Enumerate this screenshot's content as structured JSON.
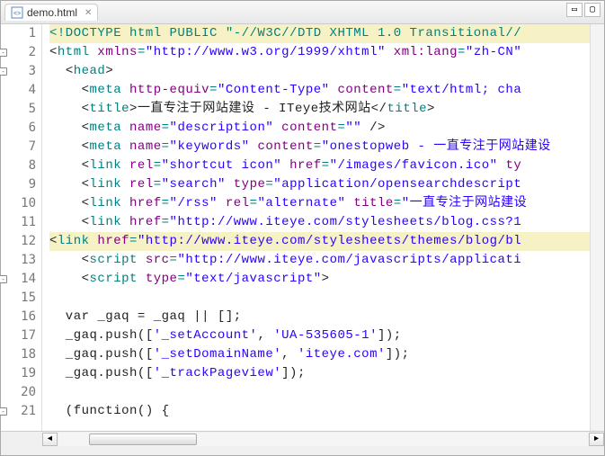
{
  "tab": {
    "label": "demo.html",
    "close_glyph": "✕"
  },
  "window": {
    "min_glyph": "▭",
    "max_glyph": "▢"
  },
  "lines": [
    {
      "n": 1,
      "fold": null,
      "hilite": true,
      "segs": [
        {
          "c": "tok-doctype",
          "t": "<!DOCTYPE html PUBLIC \"-//W3C//DTD XHTML 1.0 Transitional//"
        }
      ]
    },
    {
      "n": 2,
      "fold": "-",
      "hilite": false,
      "segs": [
        {
          "c": "tok-bracket",
          "t": "<"
        },
        {
          "c": "tok-tag",
          "t": "html "
        },
        {
          "c": "tok-attr",
          "t": "xmlns"
        },
        {
          "c": "tok-tag",
          "t": "="
        },
        {
          "c": "tok-str",
          "t": "\"http://www.w3.org/1999/xhtml\""
        },
        {
          "c": "tok-tag",
          "t": " "
        },
        {
          "c": "tok-attr",
          "t": "xml:lang"
        },
        {
          "c": "tok-tag",
          "t": "="
        },
        {
          "c": "tok-str",
          "t": "\"zh-CN\""
        }
      ]
    },
    {
      "n": 3,
      "fold": "-",
      "hilite": false,
      "segs": [
        {
          "c": "tok-text",
          "t": "  "
        },
        {
          "c": "tok-bracket",
          "t": "<"
        },
        {
          "c": "tok-tag",
          "t": "head"
        },
        {
          "c": "tok-bracket",
          "t": ">"
        }
      ]
    },
    {
      "n": 4,
      "fold": null,
      "hilite": false,
      "segs": [
        {
          "c": "tok-text",
          "t": "    "
        },
        {
          "c": "tok-bracket",
          "t": "<"
        },
        {
          "c": "tok-tag",
          "t": "meta "
        },
        {
          "c": "tok-attr",
          "t": "http-equiv"
        },
        {
          "c": "tok-tag",
          "t": "="
        },
        {
          "c": "tok-str",
          "t": "\"Content-Type\""
        },
        {
          "c": "tok-tag",
          "t": " "
        },
        {
          "c": "tok-attr",
          "t": "content"
        },
        {
          "c": "tok-tag",
          "t": "="
        },
        {
          "c": "tok-str",
          "t": "\"text/html; cha"
        }
      ]
    },
    {
      "n": 5,
      "fold": null,
      "hilite": false,
      "segs": [
        {
          "c": "tok-text",
          "t": "    "
        },
        {
          "c": "tok-bracket",
          "t": "<"
        },
        {
          "c": "tok-tag",
          "t": "title"
        },
        {
          "c": "tok-bracket",
          "t": ">"
        },
        {
          "c": "tok-text",
          "t": "一直专注于网站建设 - ITeye技术网站"
        },
        {
          "c": "tok-bracket",
          "t": "</"
        },
        {
          "c": "tok-tag",
          "t": "title"
        },
        {
          "c": "tok-bracket",
          "t": ">"
        }
      ]
    },
    {
      "n": 6,
      "fold": null,
      "hilite": false,
      "segs": [
        {
          "c": "tok-text",
          "t": "    "
        },
        {
          "c": "tok-bracket",
          "t": "<"
        },
        {
          "c": "tok-tag",
          "t": "meta "
        },
        {
          "c": "tok-attr",
          "t": "name"
        },
        {
          "c": "tok-tag",
          "t": "="
        },
        {
          "c": "tok-str",
          "t": "\"description\""
        },
        {
          "c": "tok-tag",
          "t": " "
        },
        {
          "c": "tok-attr",
          "t": "content"
        },
        {
          "c": "tok-tag",
          "t": "="
        },
        {
          "c": "tok-str",
          "t": "\"\""
        },
        {
          "c": "tok-tag",
          "t": " "
        },
        {
          "c": "tok-bracket",
          "t": "/>"
        }
      ]
    },
    {
      "n": 7,
      "fold": null,
      "hilite": false,
      "segs": [
        {
          "c": "tok-text",
          "t": "    "
        },
        {
          "c": "tok-bracket",
          "t": "<"
        },
        {
          "c": "tok-tag",
          "t": "meta "
        },
        {
          "c": "tok-attr",
          "t": "name"
        },
        {
          "c": "tok-tag",
          "t": "="
        },
        {
          "c": "tok-str",
          "t": "\"keywords\""
        },
        {
          "c": "tok-tag",
          "t": " "
        },
        {
          "c": "tok-attr",
          "t": "content"
        },
        {
          "c": "tok-tag",
          "t": "="
        },
        {
          "c": "tok-str",
          "t": "\"onestopweb - 一直专注于网站建设"
        }
      ]
    },
    {
      "n": 8,
      "fold": null,
      "hilite": false,
      "segs": [
        {
          "c": "tok-text",
          "t": "    "
        },
        {
          "c": "tok-bracket",
          "t": "<"
        },
        {
          "c": "tok-tag",
          "t": "link "
        },
        {
          "c": "tok-attr",
          "t": "rel"
        },
        {
          "c": "tok-tag",
          "t": "="
        },
        {
          "c": "tok-str",
          "t": "\"shortcut icon\""
        },
        {
          "c": "tok-tag",
          "t": " "
        },
        {
          "c": "tok-attr",
          "t": "href"
        },
        {
          "c": "tok-tag",
          "t": "="
        },
        {
          "c": "tok-str",
          "t": "\"/images/favicon.ico\""
        },
        {
          "c": "tok-tag",
          "t": " "
        },
        {
          "c": "tok-attr",
          "t": "ty"
        }
      ]
    },
    {
      "n": 9,
      "fold": null,
      "hilite": false,
      "segs": [
        {
          "c": "tok-text",
          "t": "    "
        },
        {
          "c": "tok-bracket",
          "t": "<"
        },
        {
          "c": "tok-tag",
          "t": "link "
        },
        {
          "c": "tok-attr",
          "t": "rel"
        },
        {
          "c": "tok-tag",
          "t": "="
        },
        {
          "c": "tok-str",
          "t": "\"search\""
        },
        {
          "c": "tok-tag",
          "t": " "
        },
        {
          "c": "tok-attr",
          "t": "type"
        },
        {
          "c": "tok-tag",
          "t": "="
        },
        {
          "c": "tok-str",
          "t": "\"application/opensearchdescript"
        }
      ]
    },
    {
      "n": 10,
      "fold": null,
      "hilite": false,
      "segs": [
        {
          "c": "tok-text",
          "t": "    "
        },
        {
          "c": "tok-bracket",
          "t": "<"
        },
        {
          "c": "tok-tag",
          "t": "link "
        },
        {
          "c": "tok-attr",
          "t": "href"
        },
        {
          "c": "tok-tag",
          "t": "="
        },
        {
          "c": "tok-str",
          "t": "\"/rss\""
        },
        {
          "c": "tok-tag",
          "t": " "
        },
        {
          "c": "tok-attr",
          "t": "rel"
        },
        {
          "c": "tok-tag",
          "t": "="
        },
        {
          "c": "tok-str",
          "t": "\"alternate\""
        },
        {
          "c": "tok-tag",
          "t": " "
        },
        {
          "c": "tok-attr",
          "t": "title"
        },
        {
          "c": "tok-tag",
          "t": "="
        },
        {
          "c": "tok-str",
          "t": "\"一直专注于网站建设"
        }
      ]
    },
    {
      "n": 11,
      "fold": null,
      "hilite": false,
      "segs": [
        {
          "c": "tok-text",
          "t": "    "
        },
        {
          "c": "tok-bracket",
          "t": "<"
        },
        {
          "c": "tok-tag",
          "t": "link "
        },
        {
          "c": "tok-attr",
          "t": "href"
        },
        {
          "c": "tok-tag",
          "t": "="
        },
        {
          "c": "tok-str",
          "t": "\"http://www.iteye.com/stylesheets/blog.css?1"
        }
      ]
    },
    {
      "n": 12,
      "fold": null,
      "hilite": true,
      "segs": [
        {
          "c": "tok-bracket",
          "t": "<"
        },
        {
          "c": "tok-tag",
          "t": "link "
        },
        {
          "c": "tok-attr",
          "t": "href"
        },
        {
          "c": "tok-tag",
          "t": "="
        },
        {
          "c": "tok-str",
          "t": "\"http://www.iteye.com/stylesheets/themes/blog/bl"
        }
      ]
    },
    {
      "n": 13,
      "fold": null,
      "hilite": false,
      "segs": [
        {
          "c": "tok-text",
          "t": "    "
        },
        {
          "c": "tok-bracket",
          "t": "<"
        },
        {
          "c": "tok-tag",
          "t": "script "
        },
        {
          "c": "tok-attr",
          "t": "src"
        },
        {
          "c": "tok-tag",
          "t": "="
        },
        {
          "c": "tok-str",
          "t": "\"http://www.iteye.com/javascripts/applicati"
        }
      ]
    },
    {
      "n": 14,
      "fold": "-",
      "hilite": false,
      "segs": [
        {
          "c": "tok-text",
          "t": "    "
        },
        {
          "c": "tok-bracket",
          "t": "<"
        },
        {
          "c": "tok-tag",
          "t": "script "
        },
        {
          "c": "tok-attr",
          "t": "type"
        },
        {
          "c": "tok-tag",
          "t": "="
        },
        {
          "c": "tok-str",
          "t": "\"text/javascript\""
        },
        {
          "c": "tok-bracket",
          "t": ">"
        }
      ]
    },
    {
      "n": 15,
      "fold": null,
      "hilite": false,
      "segs": [
        {
          "c": "tok-text",
          "t": ""
        }
      ]
    },
    {
      "n": 16,
      "fold": null,
      "hilite": false,
      "segs": [
        {
          "c": "tok-js",
          "t": "  var _gaq = _gaq || [];"
        }
      ]
    },
    {
      "n": 17,
      "fold": null,
      "hilite": false,
      "segs": [
        {
          "c": "tok-js",
          "t": "  _gaq.push(["
        },
        {
          "c": "tok-jsstr",
          "t": "'_setAccount'"
        },
        {
          "c": "tok-js",
          "t": ", "
        },
        {
          "c": "tok-jsstr",
          "t": "'UA-535605-1'"
        },
        {
          "c": "tok-js",
          "t": "]);"
        }
      ]
    },
    {
      "n": 18,
      "fold": null,
      "hilite": false,
      "segs": [
        {
          "c": "tok-js",
          "t": "  _gaq.push(["
        },
        {
          "c": "tok-jsstr",
          "t": "'_setDomainName'"
        },
        {
          "c": "tok-js",
          "t": ", "
        },
        {
          "c": "tok-jsstr",
          "t": "'iteye.com'"
        },
        {
          "c": "tok-js",
          "t": "]);"
        }
      ]
    },
    {
      "n": 19,
      "fold": null,
      "hilite": false,
      "segs": [
        {
          "c": "tok-js",
          "t": "  _gaq.push(["
        },
        {
          "c": "tok-jsstr",
          "t": "'_trackPageview'"
        },
        {
          "c": "tok-js",
          "t": "]);"
        }
      ]
    },
    {
      "n": 20,
      "fold": null,
      "hilite": false,
      "segs": [
        {
          "c": "tok-text",
          "t": ""
        }
      ]
    },
    {
      "n": 21,
      "fold": "-",
      "hilite": false,
      "segs": [
        {
          "c": "tok-js",
          "t": "  (function() {"
        }
      ]
    }
  ]
}
